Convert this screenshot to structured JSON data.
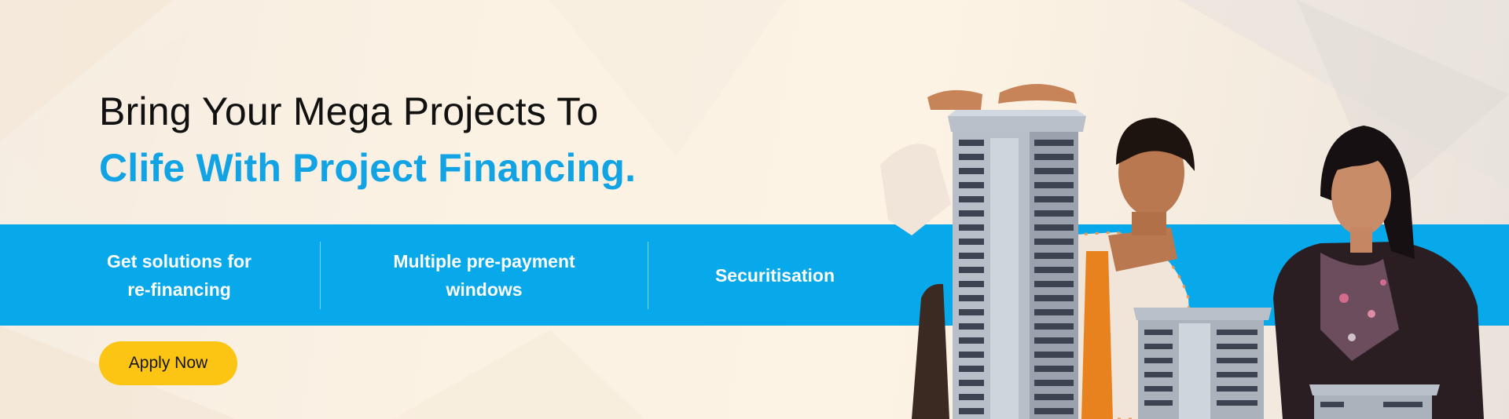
{
  "banner": {
    "headline_line1": "Bring Your Mega Projects To",
    "headline_line2": "Clife With Project Financing.",
    "features": [
      {
        "line1": "Get solutions for",
        "line2": "re-financing"
      },
      {
        "line1": "Multiple pre-payment",
        "line2": "windows"
      },
      {
        "line1": "Securitisation"
      }
    ],
    "cta_label": "Apply Now"
  },
  "colors": {
    "accent_blue": "#08a9ea",
    "headline_blue": "#11a3e3",
    "cta_yellow": "#fdc513",
    "background": "#fbf2e3"
  },
  "illustration": {
    "icons": [
      "tall-building-model",
      "man-pointing",
      "woman-looking",
      "small-building-model"
    ]
  }
}
